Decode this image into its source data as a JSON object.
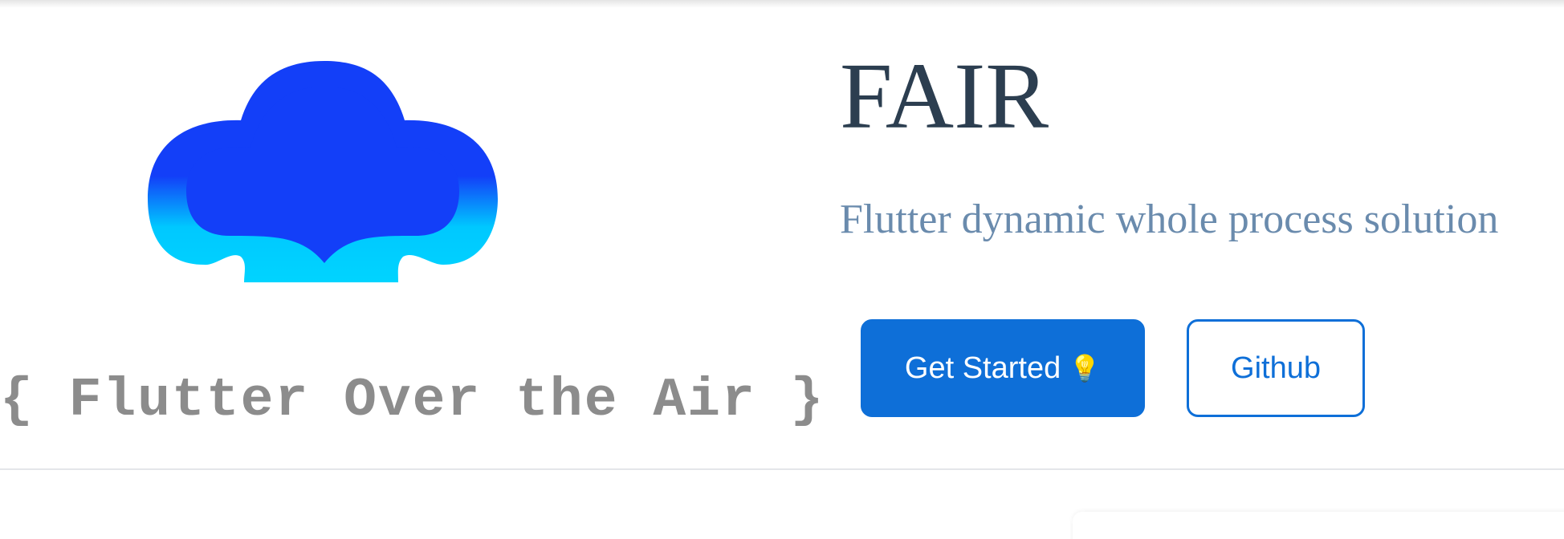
{
  "logo": {
    "icon": "cloud-logo-icon",
    "tagline": "{ Flutter Over the Air }",
    "colors": {
      "cloud_top": "#133ff8",
      "cloud_bottom": "#00c8ff"
    }
  },
  "hero": {
    "title": "FAIR",
    "subtitle": "Flutter dynamic whole process solution"
  },
  "actions": {
    "get_started_label": "Get Started",
    "get_started_icon": "💡",
    "github_label": "Github"
  },
  "colors": {
    "accent": "#0e6fd8",
    "title": "#2c3e50",
    "subtitle": "#6a8bad",
    "tagline": "#8c8c8c"
  }
}
